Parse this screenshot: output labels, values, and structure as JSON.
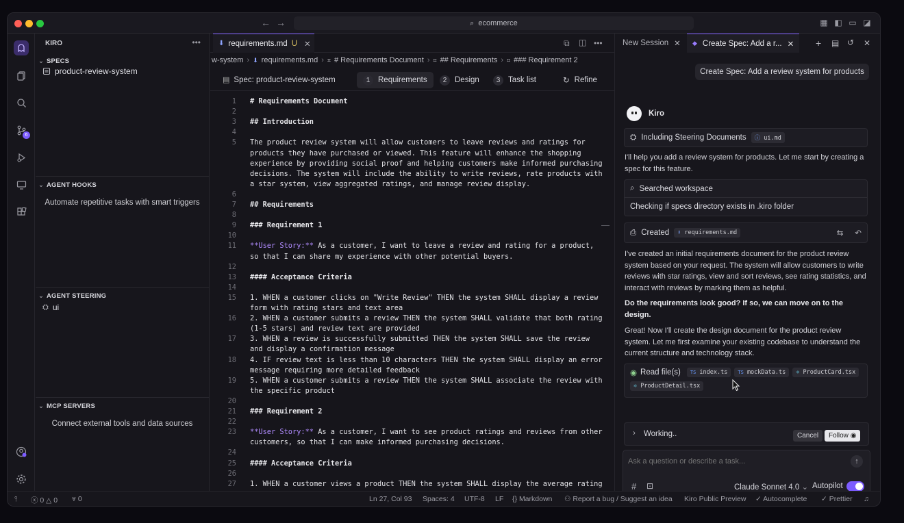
{
  "titlebar": {
    "search": "ecommerce",
    "colors": {
      "red": "#ff5f57",
      "yellow": "#febc2e",
      "green": "#28c840"
    }
  },
  "activity_badge": "6",
  "sidebar": {
    "title": "KIRO",
    "specs_title": "SPECS",
    "spec_item": "product-review-system",
    "hooks_title": "AGENT HOOKS",
    "hooks_msg": "Automate repetitive tasks with smart triggers",
    "steering_title": "AGENT STEERING",
    "steering_item": "ui",
    "mcp_title": "MCP SERVERS",
    "mcp_msg": "Connect external tools and data sources"
  },
  "editor": {
    "tab_label": "requirements.md",
    "tab_flag": "U",
    "breadcrumb": [
      "w-system",
      "requirements.md",
      "# Requirements Document",
      "## Requirements",
      "### Requirement 2"
    ],
    "spec_name": "Spec: product-review-system",
    "spec_tabs": [
      {
        "num": "1",
        "label": "Requirements"
      },
      {
        "num": "2",
        "label": "Design"
      },
      {
        "num": "3",
        "label": "Task list"
      }
    ],
    "refine": "Refine",
    "lines": [
      {
        "n": "1",
        "t": "# Requirements Document",
        "h": true
      },
      {
        "n": "2",
        "t": ""
      },
      {
        "n": "3",
        "t": "## Introduction",
        "h": true
      },
      {
        "n": "4",
        "t": ""
      },
      {
        "n": "5",
        "t": "The product review system will allow customers to leave reviews and ratings for"
      },
      {
        "n": "",
        "t": "products they have purchased or viewed. This feature will enhance the shopping"
      },
      {
        "n": "",
        "t": "experience by providing social proof and helping customers make informed purchasing"
      },
      {
        "n": "",
        "t": "decisions. The system will include the ability to write reviews, rate products with"
      },
      {
        "n": "",
        "t": "a star system, view aggregated ratings, and manage review display."
      },
      {
        "n": "6",
        "t": ""
      },
      {
        "n": "7",
        "t": "## Requirements",
        "h": true
      },
      {
        "n": "8",
        "t": ""
      },
      {
        "n": "9",
        "t": "### Requirement 1",
        "h": true
      },
      {
        "n": "10",
        "t": ""
      },
      {
        "n": "11",
        "us": "**User Story:**",
        "t": " As a customer, I want to leave a review and rating for a product,"
      },
      {
        "n": "",
        "t": "so that I can share my experience with other potential buyers."
      },
      {
        "n": "12",
        "t": ""
      },
      {
        "n": "13",
        "t": "#### Acceptance Criteria",
        "h": true
      },
      {
        "n": "14",
        "t": ""
      },
      {
        "n": "15",
        "t": "1. WHEN a customer clicks on \"Write Review\" THEN the system SHALL display a review"
      },
      {
        "n": "",
        "t": "form with rating stars and text area"
      },
      {
        "n": "16",
        "t": "2. WHEN a customer submits a review THEN the system SHALL validate that both rating"
      },
      {
        "n": "",
        "t": "(1-5 stars) and review text are provided"
      },
      {
        "n": "17",
        "t": "3. WHEN a review is successfully submitted THEN the system SHALL save the review"
      },
      {
        "n": "",
        "t": "and display a confirmation message"
      },
      {
        "n": "18",
        "t": "4. IF review text is less than 10 characters THEN the system SHALL display an error"
      },
      {
        "n": "",
        "t": "message requiring more detailed feedback"
      },
      {
        "n": "19",
        "t": "5. WHEN a customer submits a review THEN the system SHALL associate the review with"
      },
      {
        "n": "",
        "t": "the specific product"
      },
      {
        "n": "20",
        "t": ""
      },
      {
        "n": "21",
        "t": "### Requirement 2",
        "h": true
      },
      {
        "n": "22",
        "t": ""
      },
      {
        "n": "23",
        "us": "**User Story:**",
        "t": " As a customer, I want to see product ratings and reviews from other"
      },
      {
        "n": "",
        "t": "customers, so that I can make informed purchasing decisions."
      },
      {
        "n": "24",
        "t": ""
      },
      {
        "n": "25",
        "t": "#### Acceptance Criteria",
        "h": true
      },
      {
        "n": "26",
        "t": ""
      },
      {
        "n": "27",
        "t": "1. WHEN a customer views a product THEN the system SHALL display the average rating"
      }
    ]
  },
  "chat": {
    "tab_new": "New Session",
    "tab_spec": "Create Spec: Add a r...",
    "user_msg": "Create Spec: Add a review system for products",
    "agent_name": "Kiro",
    "steering_label": "Including Steering Documents",
    "steering_chip": "ui.md",
    "intro": "I'll help you add a review system for products. Let me start by creating a spec for this feature.",
    "searched": "Searched workspace",
    "searched_detail": "Checking if specs directory exists in .kiro folder",
    "created": "Created",
    "created_chip": "requirements.md",
    "summary": "I've created an initial requirements document for the product review system based on your request. The system will allow customers to write reviews with star ratings, view and sort reviews, see rating statistics, and interact with reviews by marking them as helpful.",
    "question": "Do the requirements look good? If so, we can move on to the design.",
    "next": "Great! Now I'll create the design document for the product review system. Let me first examine your existing codebase to understand the current structure and technology stack.",
    "read_label": "Read file(s)",
    "read_files": [
      "index.ts",
      "mockData.ts",
      "ProductCard.tsx",
      "ProductDetail.tsx"
    ],
    "working": "Working..",
    "cancel": "Cancel",
    "follow": "Follow",
    "placeholder": "Ask a question or describe a task...",
    "model": "Claude Sonnet 4.0",
    "autopilot": "Autopilot"
  },
  "statusbar": {
    "errors": "0",
    "warnings": "0",
    "ports": "0",
    "position": "Ln 27, Col 93",
    "spaces": "Spaces: 4",
    "encoding": "UTF-8",
    "eol": "LF",
    "language": "Markdown",
    "report": "Report a bug / Suggest an idea",
    "preview": "Kiro Public Preview",
    "autocomplete": "Autocomplete",
    "prettier": "Prettier"
  }
}
